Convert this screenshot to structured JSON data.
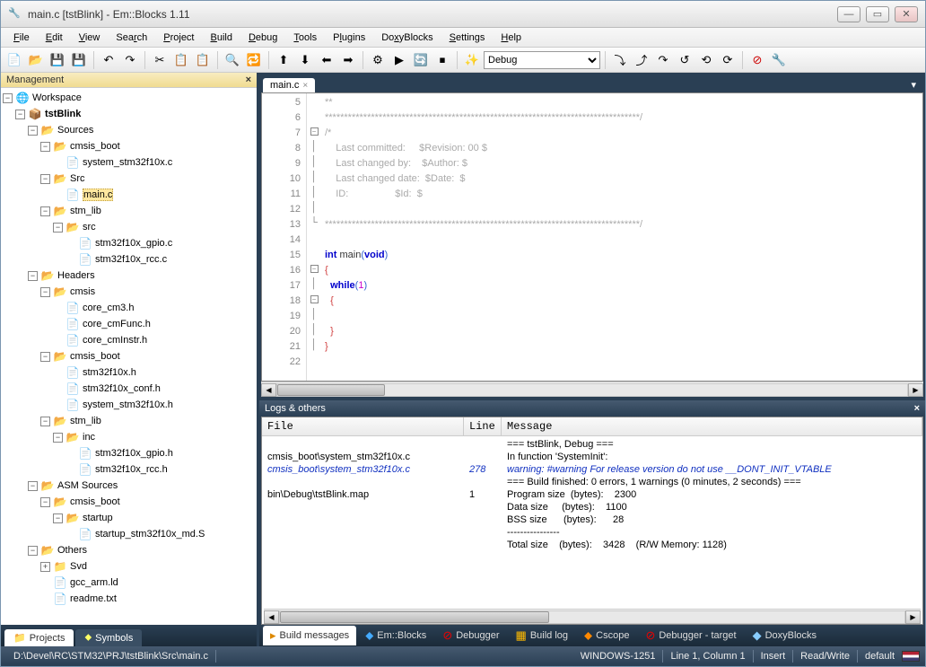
{
  "window_title": "main.c [tstBlink] - Em::Blocks 1.11",
  "menu": [
    "File",
    "Edit",
    "View",
    "Search",
    "Project",
    "Build",
    "Debug",
    "Tools",
    "Plugins",
    "DoxyBlocks",
    "Settings",
    "Help"
  ],
  "toolbar_config": "Debug",
  "sidebar": {
    "panel_title": "Management",
    "root": "Workspace",
    "project": "tstBlink",
    "sources": "Sources",
    "cmsis_boot": "cmsis_boot",
    "system_stm32": "system_stm32f10x.c",
    "src_folder": "Src",
    "main_c": "main.c",
    "stm_lib": "stm_lib",
    "src_sub": "src",
    "gpio_c": "stm32f10x_gpio.c",
    "rcc_c": "stm32f10x_rcc.c",
    "headers": "Headers",
    "cmsis": "cmsis",
    "core_cm3": "core_cm3.h",
    "core_cmfunc": "core_cmFunc.h",
    "core_cminstr": "core_cmInstr.h",
    "cmsis_boot_h": "cmsis_boot",
    "stm32f10x_h": "stm32f10x.h",
    "stm32f10x_conf": "stm32f10x_conf.h",
    "system_stm32_h": "system_stm32f10x.h",
    "stm_lib_h": "stm_lib",
    "inc": "inc",
    "gpio_h": "stm32f10x_gpio.h",
    "rcc_h": "stm32f10x_rcc.h",
    "asm_sources": "ASM Sources",
    "asm_cmsis_boot": "cmsis_boot",
    "startup": "startup",
    "startup_s": "startup_stm32f10x_md.S",
    "others": "Others",
    "svd": "Svd",
    "gcc_arm": "gcc_arm.ld",
    "readme": "readme.txt",
    "tab_projects": "Projects",
    "tab_symbols": "Symbols"
  },
  "editor": {
    "tab": "main.c",
    "lines": [
      "5",
      "6",
      "7",
      "8",
      "9",
      "10",
      "11",
      "12",
      "13",
      "14",
      "15",
      "16",
      "17",
      "18",
      "19",
      "20",
      "21",
      "22"
    ],
    "l5": "**",
    "l6": "**********************************************************************************/",
    "l7": "/*",
    "l8": "    Last committed:     $Revision: 00 $",
    "l9": "    Last changed by:    $Author: $",
    "l10": "    Last changed date:  $Date:  $",
    "l11": "    ID:                 $Id:  $",
    "l12": "",
    "l13": "**********************************************************************************/",
    "l14": "",
    "kw_int": "int",
    "fn_main": " main",
    "kw_void": "void",
    "kw_while": "while",
    "num_1": "1"
  },
  "logs": {
    "panel_title": "Logs & others",
    "h_file": "File",
    "h_line": "Line",
    "h_msg": "Message",
    "r1_msg": "=== tstBlink, Debug ===",
    "r2_file": "cmsis_boot\\system_stm32f10x.c",
    "r2_msg": "In function 'SystemInit':",
    "r3_file": "cmsis_boot\\system_stm32f10x.c",
    "r3_line": "278",
    "r3_msg": "warning: #warning For release version do not use __DONT_INIT_VTABLE",
    "r4_msg": "=== Build finished: 0 errors, 1 warnings (0 minutes, 2 seconds) ===",
    "r5_file": "bin\\Debug\\tstBlink.map",
    "r5_line": "1",
    "r5_msg": "Program size  (bytes):    2300",
    "r6_msg": "Data size     (bytes):    1100",
    "r7_msg": "BSS size      (bytes):      28",
    "r8_msg": "----------------",
    "r9_msg": "Total size    (bytes):    3428    (R/W Memory: 1128)"
  },
  "bottom_tabs": {
    "build_messages": "Build messages",
    "emblocks": "Em::Blocks",
    "debugger": "Debugger",
    "build_log": "Build log",
    "cscope": "Cscope",
    "debugger_target": "Debugger - target",
    "doxyblocks": "DoxyBlocks"
  },
  "status": {
    "path": "D:\\Devel\\RC\\STM32\\PRJ\\tstBlink\\Src\\main.c",
    "encoding": "WINDOWS-1251",
    "pos": "Line 1, Column 1",
    "insert": "Insert",
    "rw": "Read/Write",
    "config": "default"
  }
}
